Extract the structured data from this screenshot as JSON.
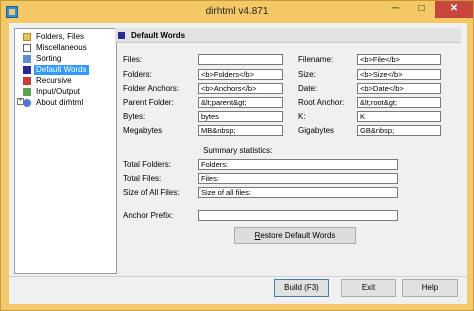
{
  "window": {
    "title": "dirhtml v4.871",
    "minimize": "─",
    "maximize": "□",
    "close": "✕"
  },
  "tree": {
    "items": [
      {
        "label": "Folders, Files",
        "icon": "folder-icon"
      },
      {
        "label": "Miscellaneous",
        "icon": "list-icon"
      },
      {
        "label": "Sorting",
        "icon": "sort-icon"
      },
      {
        "label": "Default Words",
        "icon": "words-icon",
        "selected": true
      },
      {
        "label": "Recursive",
        "icon": "recursive-icon"
      },
      {
        "label": "Input/Output",
        "icon": "io-icon"
      },
      {
        "label": "About dirhtml",
        "icon": "about-icon"
      }
    ],
    "expander": "+"
  },
  "panel": {
    "title": "Default Words"
  },
  "fields": {
    "files_label": "Files:",
    "files_value": "",
    "filename_label": "Filename:",
    "filename_value": "<b>File</b>",
    "folders_label": "Folders:",
    "folders_value": "<b>Folders</b>",
    "size_label": "Size:",
    "size_value": "<b>Size</b>",
    "folder_anchors_label": "Folder Anchors:",
    "folder_anchors_value": "<b>Anchors</b>",
    "date_label": "Date:",
    "date_value": "<b>Date</b>",
    "parent_folder_label": "Parent Folder:",
    "parent_folder_value": "&lt;parent&gt;",
    "root_anchor_label": "Root Anchor:",
    "root_anchor_value": "&lt;root&gt;",
    "bytes_label": "Bytes:",
    "bytes_value": "bytes",
    "k_label": "K:",
    "k_value": "K",
    "megabytes_label": "Megabytes",
    "megabytes_value": "MB&nbsp;",
    "gigabytes_label": "Gigabytes",
    "gigabytes_value": "GB&nbsp;"
  },
  "summary": {
    "heading": "Summary statistics:",
    "total_folders_label": "Total Folders:",
    "total_folders_value": "Folders:",
    "total_files_label": "Total Files:",
    "total_files_value": "Files:",
    "size_all_label": "Size of All Files:",
    "size_all_value": "Size of all files:"
  },
  "anchor_prefix": {
    "label": "Anchor Prefix:",
    "value": ""
  },
  "restore_button": {
    "underline": "R",
    "rest": "estore Default Words"
  },
  "footer": {
    "build": "Build (F3)",
    "exit": "Exit",
    "help": "Help"
  }
}
